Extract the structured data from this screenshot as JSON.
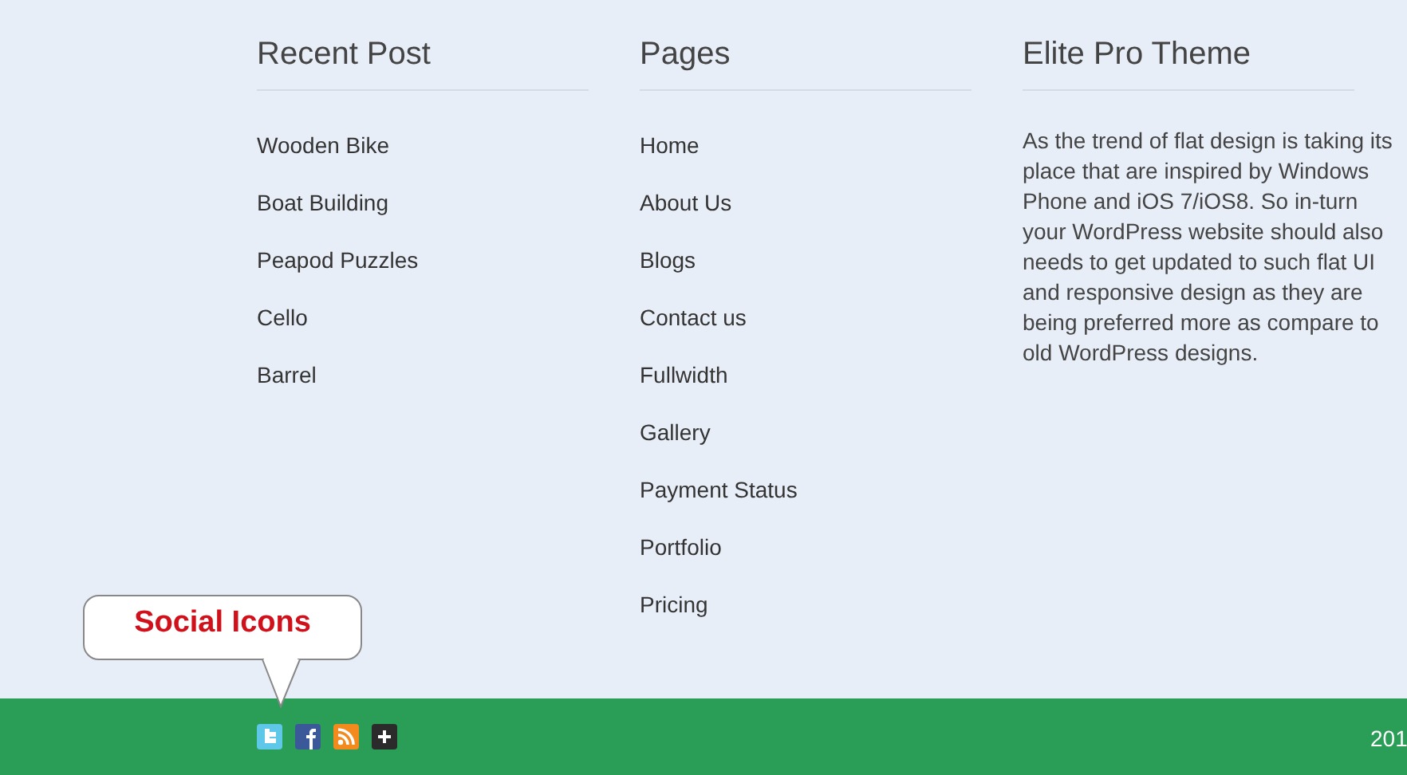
{
  "columns": [
    {
      "title": "Recent Post",
      "links": [
        "Wooden Bike",
        "Boat Building",
        "Peapod Puzzles",
        "Cello",
        "Barrel"
      ]
    },
    {
      "title": "Pages",
      "links": [
        "Home",
        "About Us",
        "Blogs",
        "Contact us",
        "Fullwidth",
        "Gallery",
        "Payment Status",
        "Portfolio",
        "Pricing"
      ]
    },
    {
      "title": "Elite Pro Theme",
      "text": "As the trend of flat design is taking its place that are inspired by Windows Phone and iOS 7/iOS8. So in-turn your WordPress website should also needs to get updated to such flat UI and responsive design as they are being preferred more as compare to old WordPress designs."
    }
  ],
  "callout": "Social Icons",
  "social": [
    {
      "kind": "twitter"
    },
    {
      "kind": "facebook"
    },
    {
      "kind": "rss"
    },
    {
      "kind": "plus"
    }
  ],
  "copyright": "201"
}
